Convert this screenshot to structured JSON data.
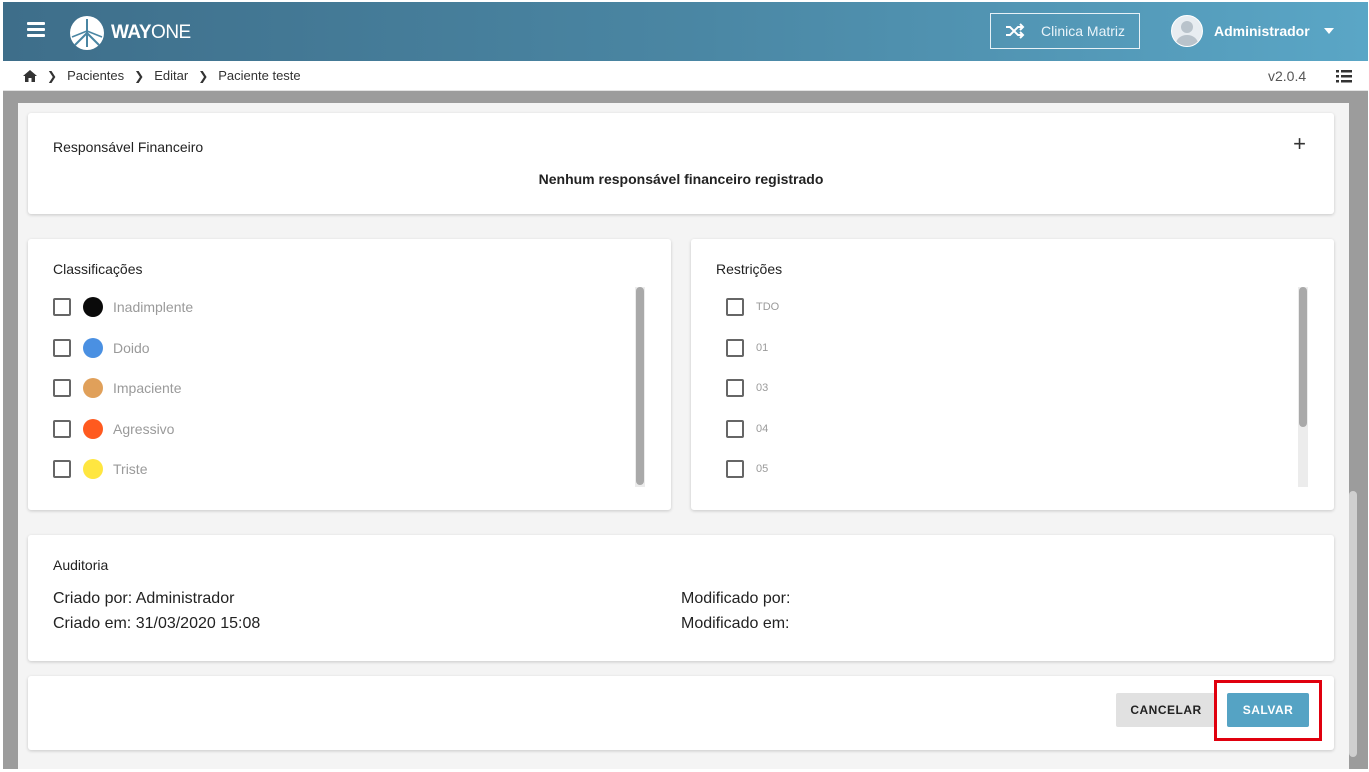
{
  "header": {
    "logo_text_bold": "WAY",
    "logo_text_light": "ONE",
    "clinic_label": "Clinica Matriz",
    "user_name": "Administrador"
  },
  "breadcrumb": {
    "items": [
      "Pacientes",
      "Editar",
      "Paciente teste"
    ],
    "version": "v2.0.4"
  },
  "responsavel": {
    "title": "Responsável Financeiro",
    "add_symbol": "+",
    "empty_message": "Nenhum responsável financeiro registrado"
  },
  "classificacoes": {
    "title": "Classificações",
    "items": [
      {
        "label": "Inadimplente",
        "color": "#0a0a0a"
      },
      {
        "label": "Doido",
        "color": "#4a90e2"
      },
      {
        "label": "Impaciente",
        "color": "#e0a05a"
      },
      {
        "label": "Agressivo",
        "color": "#ff5a1f"
      },
      {
        "label": "Triste",
        "color": "#ffe640"
      }
    ]
  },
  "restricoes": {
    "title": "Restrições",
    "items": [
      "TDO",
      "01",
      "03",
      "04",
      "05"
    ]
  },
  "auditoria": {
    "title": "Auditoria",
    "criado_por": "Criado por: Administrador",
    "criado_em": "Criado em: 31/03/2020 15:08",
    "modificado_por": "Modificado por:",
    "modificado_em": "Modificado em:"
  },
  "actions": {
    "cancel_label": "CANCELAR",
    "save_label": "SALVAR"
  }
}
